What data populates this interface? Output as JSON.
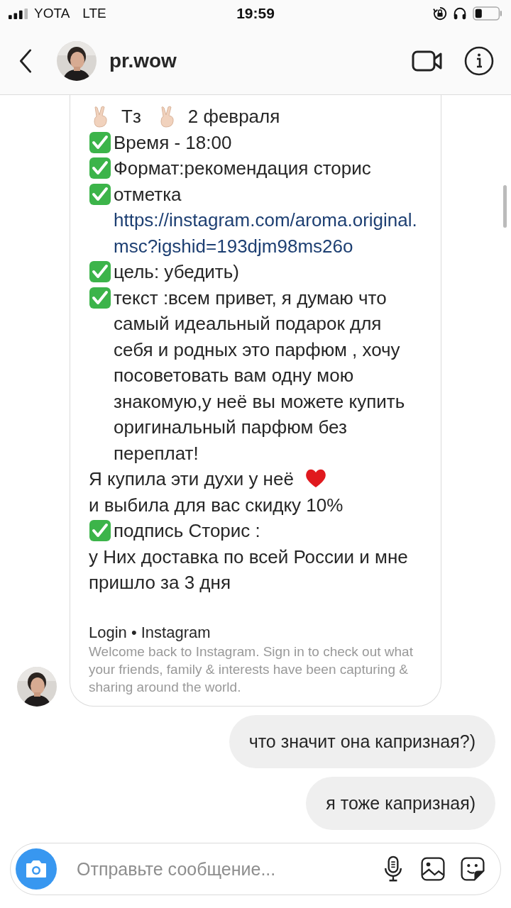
{
  "status_bar": {
    "carrier": "YOTA",
    "network": "LTE",
    "time": "19:59"
  },
  "header": {
    "username": "pr.wow"
  },
  "messages": [
    {
      "kind": "received",
      "lines": [
        {
          "kind": "header",
          "texts": [
            "Тз",
            "2 февраля"
          ]
        },
        {
          "kind": "check",
          "text": "Время - 18:00"
        },
        {
          "kind": "check",
          "text": "Формат:рекомендация сторис"
        },
        {
          "kind": "check",
          "text": "отметка",
          "link": "https://instagram.com/aroma.original.msc?igshid=193djm98ms26o"
        },
        {
          "kind": "check",
          "text": "цель: убедить)"
        },
        {
          "kind": "check",
          "text": "текст :всем привет, я думаю что самый идеальный подарок для себя и родных это парфюм , хочу посоветовать вам одну мою знакомую,у неё вы можете купить оригинальный парфюм без переплат!"
        },
        {
          "kind": "heart",
          "text": "Я купила эти духи у неё"
        },
        {
          "kind": "plain",
          "text": "и выбила для вас скидку 10%"
        },
        {
          "kind": "check",
          "text": "подпись Сторис :"
        },
        {
          "kind": "plain",
          "text": "у Них доставка по всей России и мне пришло за 3 дня"
        }
      ],
      "preview": {
        "title": "Login • Instagram",
        "description": "Welcome back to Instagram. Sign in to check out what your friends, family & interests have been capturing & sharing around the world."
      }
    },
    {
      "kind": "sent",
      "text": "что значит она капризная?)"
    },
    {
      "kind": "sent",
      "text": "я тоже капризная)"
    }
  ],
  "composer": {
    "placeholder": "Отправьте сообщение..."
  }
}
